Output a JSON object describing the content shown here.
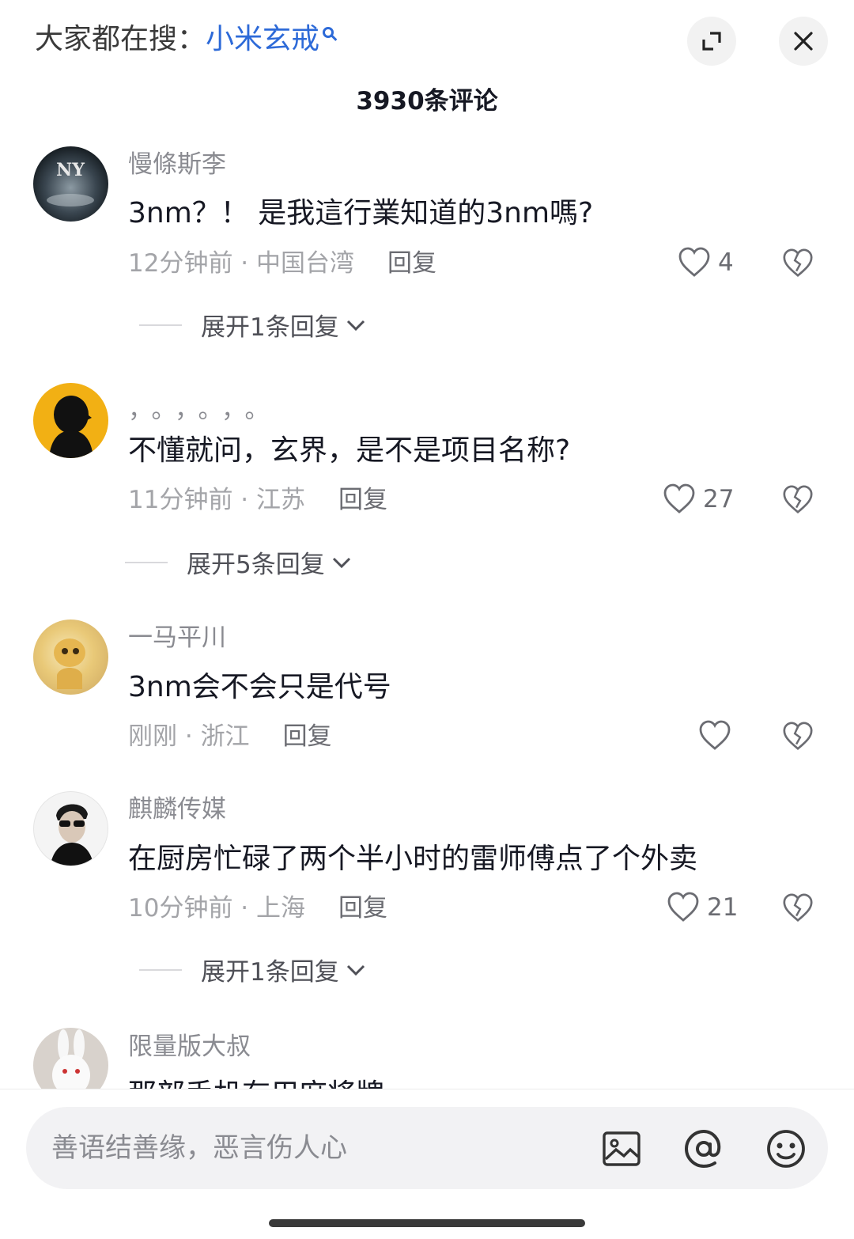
{
  "header": {
    "search_prefix": "大家都在搜：",
    "search_term": "小米玄戒",
    "comment_count": "3930条评论"
  },
  "comments": [
    {
      "username": "慢條斯李",
      "text": "3nm？！ 是我這行業知道的3nm嗎?",
      "time": "12分钟前",
      "location": "中国台湾",
      "reply_label": "回复",
      "likes": "4",
      "expand": "展开1条回复"
    },
    {
      "username": "，。，。，。",
      "text": "不懂就问，玄界，是不是项目名称?",
      "time": "11分钟前",
      "location": "江苏",
      "reply_label": "回复",
      "likes": "27",
      "expand": "展开5条回复"
    },
    {
      "username": "一马平川",
      "text": "3nm会不会只是代号",
      "time": "刚刚",
      "location": "浙江",
      "reply_label": "回复",
      "likes": ""
    },
    {
      "username": "麒麟传媒",
      "text": "在厨房忙碌了两个半小时的雷师傅点了个外卖",
      "time": "10分钟前",
      "location": "上海",
      "reply_label": "回复",
      "likes": "21",
      "expand": "展开1条回复"
    },
    {
      "username": "限量版大叔",
      "text": "那部手机有用麻将牌"
    }
  ],
  "composer": {
    "placeholder": "善语结善缘，恶言伤人心",
    "icons": [
      "image-icon",
      "at-icon",
      "emoji-icon"
    ]
  },
  "colors": {
    "accent": "#2d6ad8",
    "text_primary": "#161823",
    "text_secondary": "#8a8b91"
  }
}
